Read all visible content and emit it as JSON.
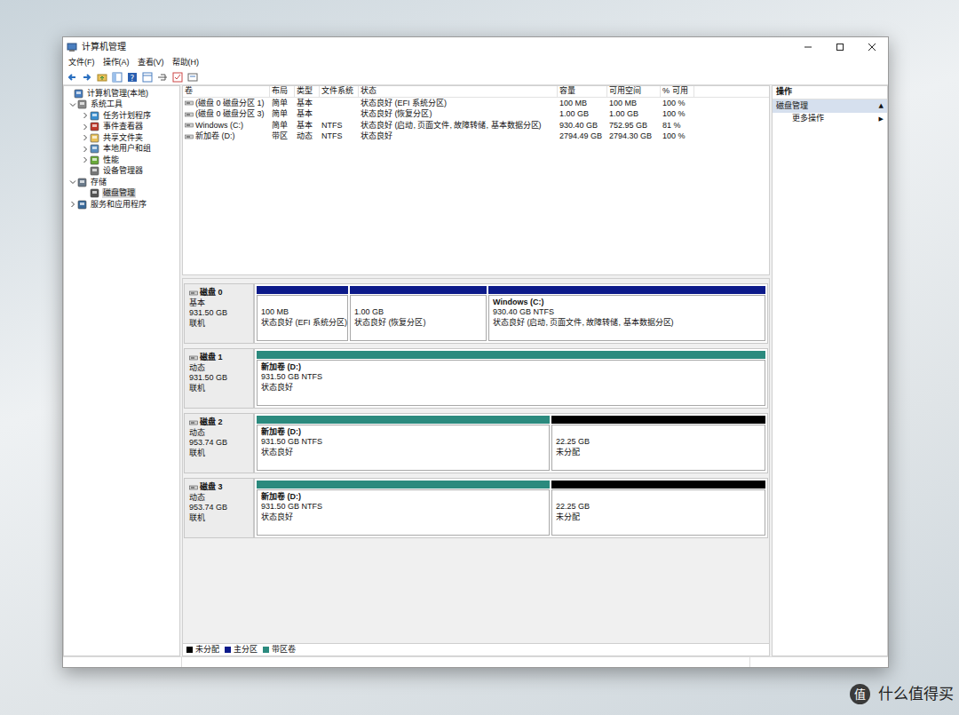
{
  "window": {
    "title": "计算机管理"
  },
  "menu": [
    "文件(F)",
    "操作(A)",
    "查看(V)",
    "帮助(H)"
  ],
  "tree": [
    {
      "label": "计算机管理(本地)",
      "expandable": false,
      "expanded": true,
      "selected": false,
      "children": [
        {
          "label": "系统工具",
          "expandable": true,
          "expanded": true,
          "selected": false,
          "children": [
            {
              "label": "任务计划程序",
              "expandable": true,
              "expanded": false,
              "selected": false,
              "children": []
            },
            {
              "label": "事件查看器",
              "expandable": true,
              "expanded": false,
              "selected": false,
              "children": []
            },
            {
              "label": "共享文件夹",
              "expandable": true,
              "expanded": false,
              "selected": false,
              "children": []
            },
            {
              "label": "本地用户和组",
              "expandable": true,
              "expanded": false,
              "selected": false,
              "children": []
            },
            {
              "label": "性能",
              "expandable": true,
              "expanded": false,
              "selected": false,
              "children": []
            },
            {
              "label": "设备管理器",
              "expandable": false,
              "expanded": false,
              "selected": false,
              "children": []
            }
          ]
        },
        {
          "label": "存储",
          "expandable": true,
          "expanded": true,
          "selected": false,
          "children": [
            {
              "label": "磁盘管理",
              "expandable": false,
              "expanded": false,
              "selected": true,
              "children": []
            }
          ]
        },
        {
          "label": "服务和应用程序",
          "expandable": true,
          "expanded": false,
          "selected": false,
          "children": []
        }
      ]
    }
  ],
  "volumes": {
    "columns": [
      "卷",
      "布局",
      "类型",
      "文件系统",
      "状态",
      "容量",
      "可用空间",
      "% 可用"
    ],
    "rows": [
      [
        "(磁盘 0 磁盘分区 1)",
        "简单",
        "基本",
        "",
        "状态良好 (EFI 系统分区)",
        "100 MB",
        "100 MB",
        "100 %"
      ],
      [
        "(磁盘 0 磁盘分区 3)",
        "简单",
        "基本",
        "",
        "状态良好 (恢复分区)",
        "1.00 GB",
        "1.00 GB",
        "100 %"
      ],
      [
        "Windows (C:)",
        "简单",
        "基本",
        "NTFS",
        "状态良好 (启动, 页面文件, 故障转储, 基本数据分区)",
        "930.40 GB",
        "752.95 GB",
        "81 %"
      ],
      [
        "新加卷 (D:)",
        "带区",
        "动态",
        "NTFS",
        "状态良好",
        "2794.49 GB",
        "2794.30 GB",
        "100 %"
      ]
    ]
  },
  "disks": [
    {
      "name": "磁盘 0",
      "type": "基本",
      "size": "931.50 GB",
      "status": "联机",
      "partitions": [
        {
          "kind": "primary",
          "size": "100 MB",
          "status": "状态良好 (EFI 系统分区)"
        },
        {
          "kind": "primary",
          "size": "1.00 GB",
          "status": "状态良好 (恢复分区)"
        },
        {
          "kind": "primary",
          "name": "Windows  (C:)",
          "size": "930.40 GB NTFS",
          "status": "状态良好 (启动, 页面文件, 故障转储, 基本数据分区)"
        }
      ]
    },
    {
      "name": "磁盘 1",
      "type": "动态",
      "size": "931.50 GB",
      "status": "联机",
      "partitions": [
        {
          "kind": "striped",
          "name": "新加卷  (D:)",
          "size": "931.50 GB NTFS",
          "status": "状态良好"
        }
      ]
    },
    {
      "name": "磁盘 2",
      "type": "动态",
      "size": "953.74 GB",
      "status": "联机",
      "partitions": [
        {
          "kind": "striped",
          "name": "新加卷  (D:)",
          "size": "931.50 GB NTFS",
          "status": "状态良好"
        },
        {
          "kind": "unallocated",
          "size": "22.25 GB",
          "status": "未分配"
        }
      ]
    },
    {
      "name": "磁盘 3",
      "type": "动态",
      "size": "953.74 GB",
      "status": "联机",
      "partitions": [
        {
          "kind": "striped",
          "name": "新加卷  (D:)",
          "size": "931.50 GB NTFS",
          "status": "状态良好"
        },
        {
          "kind": "unallocated",
          "size": "22.25 GB",
          "status": "未分配"
        }
      ]
    }
  ],
  "legend": [
    {
      "kind": "unallocated",
      "label": "未分配",
      "color": "#000000"
    },
    {
      "kind": "primary",
      "label": "主分区",
      "color": "#0c1a8a"
    },
    {
      "kind": "striped",
      "label": "带区卷",
      "color": "#2b8a7e"
    }
  ],
  "actions": {
    "title": "操作",
    "section": {
      "label": "磁盘管理",
      "arrow": "▲"
    },
    "items": [
      {
        "label": "更多操作",
        "arrow": "▶"
      }
    ]
  },
  "watermark": {
    "logo": "值",
    "text": "什么值得买"
  }
}
